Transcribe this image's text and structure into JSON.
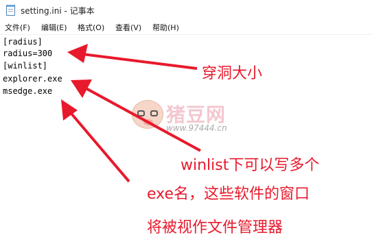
{
  "window": {
    "title": "setting.ini - 记事本"
  },
  "menu": {
    "items": [
      "文件(F)",
      "编辑(E)",
      "格式(O)",
      "查看(V)",
      "帮助(H)"
    ]
  },
  "editor": {
    "lines": [
      "[radius]",
      "radius=300",
      "[winlist]",
      "explorer.exe",
      "msedge.exe"
    ]
  },
  "annotations": {
    "radius_note": "穿洞大小",
    "winlist_note_1": "winlist下可以写多个",
    "winlist_note_2": "exe名，这些软件的窗口",
    "winlist_note_3": "将被视作文件管理器",
    "color": "#e8192c"
  },
  "watermark": {
    "title": "猪豆网",
    "url": "www.97444.cn"
  }
}
